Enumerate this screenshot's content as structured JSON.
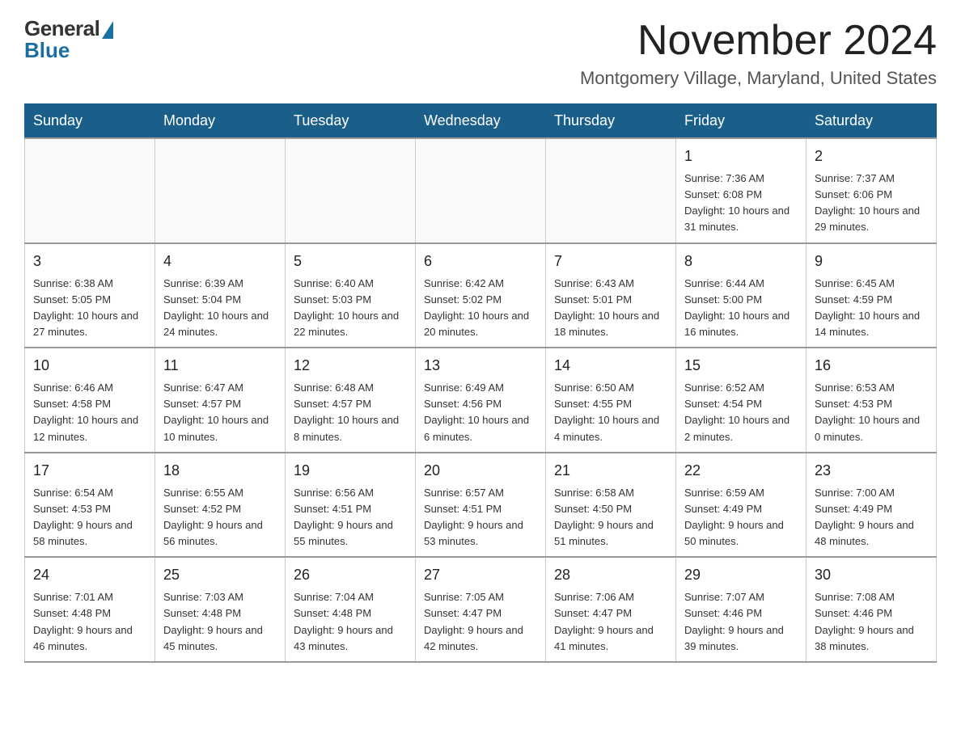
{
  "header": {
    "logo_general": "General",
    "logo_blue": "Blue",
    "title": "November 2024",
    "subtitle": "Montgomery Village, Maryland, United States"
  },
  "weekdays": [
    "Sunday",
    "Monday",
    "Tuesday",
    "Wednesday",
    "Thursday",
    "Friday",
    "Saturday"
  ],
  "weeks": [
    [
      {
        "day": "",
        "info": ""
      },
      {
        "day": "",
        "info": ""
      },
      {
        "day": "",
        "info": ""
      },
      {
        "day": "",
        "info": ""
      },
      {
        "day": "",
        "info": ""
      },
      {
        "day": "1",
        "info": "Sunrise: 7:36 AM\nSunset: 6:08 PM\nDaylight: 10 hours and 31 minutes."
      },
      {
        "day": "2",
        "info": "Sunrise: 7:37 AM\nSunset: 6:06 PM\nDaylight: 10 hours and 29 minutes."
      }
    ],
    [
      {
        "day": "3",
        "info": "Sunrise: 6:38 AM\nSunset: 5:05 PM\nDaylight: 10 hours and 27 minutes."
      },
      {
        "day": "4",
        "info": "Sunrise: 6:39 AM\nSunset: 5:04 PM\nDaylight: 10 hours and 24 minutes."
      },
      {
        "day": "5",
        "info": "Sunrise: 6:40 AM\nSunset: 5:03 PM\nDaylight: 10 hours and 22 minutes."
      },
      {
        "day": "6",
        "info": "Sunrise: 6:42 AM\nSunset: 5:02 PM\nDaylight: 10 hours and 20 minutes."
      },
      {
        "day": "7",
        "info": "Sunrise: 6:43 AM\nSunset: 5:01 PM\nDaylight: 10 hours and 18 minutes."
      },
      {
        "day": "8",
        "info": "Sunrise: 6:44 AM\nSunset: 5:00 PM\nDaylight: 10 hours and 16 minutes."
      },
      {
        "day": "9",
        "info": "Sunrise: 6:45 AM\nSunset: 4:59 PM\nDaylight: 10 hours and 14 minutes."
      }
    ],
    [
      {
        "day": "10",
        "info": "Sunrise: 6:46 AM\nSunset: 4:58 PM\nDaylight: 10 hours and 12 minutes."
      },
      {
        "day": "11",
        "info": "Sunrise: 6:47 AM\nSunset: 4:57 PM\nDaylight: 10 hours and 10 minutes."
      },
      {
        "day": "12",
        "info": "Sunrise: 6:48 AM\nSunset: 4:57 PM\nDaylight: 10 hours and 8 minutes."
      },
      {
        "day": "13",
        "info": "Sunrise: 6:49 AM\nSunset: 4:56 PM\nDaylight: 10 hours and 6 minutes."
      },
      {
        "day": "14",
        "info": "Sunrise: 6:50 AM\nSunset: 4:55 PM\nDaylight: 10 hours and 4 minutes."
      },
      {
        "day": "15",
        "info": "Sunrise: 6:52 AM\nSunset: 4:54 PM\nDaylight: 10 hours and 2 minutes."
      },
      {
        "day": "16",
        "info": "Sunrise: 6:53 AM\nSunset: 4:53 PM\nDaylight: 10 hours and 0 minutes."
      }
    ],
    [
      {
        "day": "17",
        "info": "Sunrise: 6:54 AM\nSunset: 4:53 PM\nDaylight: 9 hours and 58 minutes."
      },
      {
        "day": "18",
        "info": "Sunrise: 6:55 AM\nSunset: 4:52 PM\nDaylight: 9 hours and 56 minutes."
      },
      {
        "day": "19",
        "info": "Sunrise: 6:56 AM\nSunset: 4:51 PM\nDaylight: 9 hours and 55 minutes."
      },
      {
        "day": "20",
        "info": "Sunrise: 6:57 AM\nSunset: 4:51 PM\nDaylight: 9 hours and 53 minutes."
      },
      {
        "day": "21",
        "info": "Sunrise: 6:58 AM\nSunset: 4:50 PM\nDaylight: 9 hours and 51 minutes."
      },
      {
        "day": "22",
        "info": "Sunrise: 6:59 AM\nSunset: 4:49 PM\nDaylight: 9 hours and 50 minutes."
      },
      {
        "day": "23",
        "info": "Sunrise: 7:00 AM\nSunset: 4:49 PM\nDaylight: 9 hours and 48 minutes."
      }
    ],
    [
      {
        "day": "24",
        "info": "Sunrise: 7:01 AM\nSunset: 4:48 PM\nDaylight: 9 hours and 46 minutes."
      },
      {
        "day": "25",
        "info": "Sunrise: 7:03 AM\nSunset: 4:48 PM\nDaylight: 9 hours and 45 minutes."
      },
      {
        "day": "26",
        "info": "Sunrise: 7:04 AM\nSunset: 4:48 PM\nDaylight: 9 hours and 43 minutes."
      },
      {
        "day": "27",
        "info": "Sunrise: 7:05 AM\nSunset: 4:47 PM\nDaylight: 9 hours and 42 minutes."
      },
      {
        "day": "28",
        "info": "Sunrise: 7:06 AM\nSunset: 4:47 PM\nDaylight: 9 hours and 41 minutes."
      },
      {
        "day": "29",
        "info": "Sunrise: 7:07 AM\nSunset: 4:46 PM\nDaylight: 9 hours and 39 minutes."
      },
      {
        "day": "30",
        "info": "Sunrise: 7:08 AM\nSunset: 4:46 PM\nDaylight: 9 hours and 38 minutes."
      }
    ]
  ]
}
